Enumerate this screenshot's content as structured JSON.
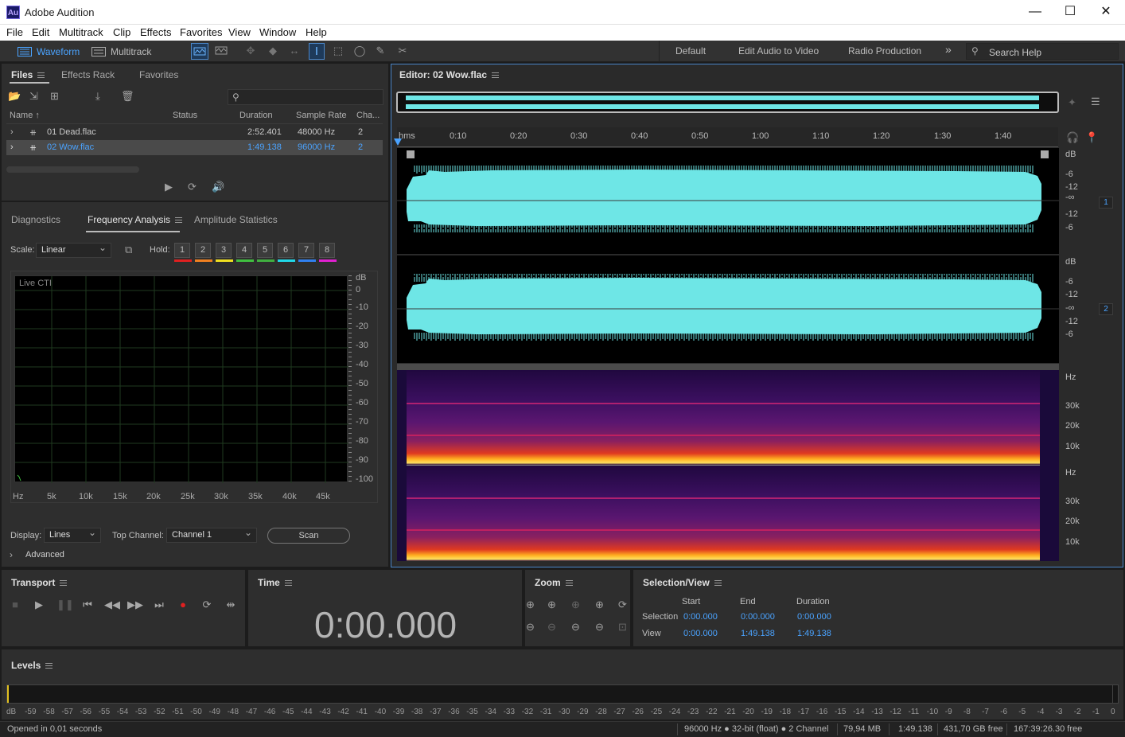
{
  "app": {
    "icon": "Au",
    "title": "Adobe Audition"
  },
  "window_controls": {
    "minimize": "—",
    "maximize": "☐",
    "close": "✕"
  },
  "menu": [
    "File",
    "Edit",
    "Multitrack",
    "Clip",
    "Effects",
    "Favorites",
    "View",
    "Window",
    "Help"
  ],
  "toolbar": {
    "waveform_label": "Waveform",
    "multitrack_label": "Multitrack",
    "workspaces": [
      "Default",
      "Edit Audio to Video",
      "Radio Production"
    ],
    "more": "»",
    "search_placeholder": "Search Help"
  },
  "files_panel": {
    "tabs": [
      "Files",
      "Effects Rack",
      "Favorites"
    ],
    "columns": {
      "name": "Name ↑",
      "status": "Status",
      "duration": "Duration",
      "sample_rate": "Sample Rate",
      "channels": "Cha..."
    },
    "rows": [
      {
        "name": "01 Dead.flac",
        "status": "",
        "duration": "2:52.401",
        "sample_rate": "48000 Hz",
        "channels": "2",
        "selected": false
      },
      {
        "name": "02 Wow.flac",
        "status": "",
        "duration": "1:49.138",
        "sample_rate": "96000 Hz",
        "channels": "2",
        "selected": true
      }
    ]
  },
  "analysis_panel": {
    "tabs": [
      "Diagnostics",
      "Frequency Analysis",
      "Amplitude Statistics"
    ],
    "scale_label": "Scale:",
    "scale_value": "Linear",
    "hold_label": "Hold:",
    "hold_buttons": [
      "1",
      "2",
      "3",
      "4",
      "5",
      "6",
      "7",
      "8"
    ],
    "hold_colors": [
      "#e02020",
      "#f08020",
      "#f0e020",
      "#40c040",
      "#40b040",
      "#20d8e8",
      "#3080f0",
      "#e020d0"
    ],
    "live_cti": "Live CTI",
    "db_labels": [
      "dB",
      "0",
      "-10",
      "-20",
      "-30",
      "-40",
      "-50",
      "-60",
      "-70",
      "-80",
      "-90",
      "-100"
    ],
    "hz_labels": [
      "Hz",
      "5k",
      "10k",
      "15k",
      "20k",
      "25k",
      "30k",
      "35k",
      "40k",
      "45k"
    ],
    "display_label": "Display:",
    "display_value": "Lines",
    "top_channel_label": "Top Channel:",
    "top_channel_value": "Channel 1",
    "scan_label": "Scan",
    "advanced_label": "Advanced"
  },
  "editor": {
    "title": "Editor: 02 Wow.flac",
    "ruler": [
      "hms",
      "0:10",
      "0:20",
      "0:30",
      "0:40",
      "0:50",
      "1:00",
      "1:10",
      "1:20",
      "1:30",
      "1:40"
    ],
    "db_scale": [
      "dB",
      "-6",
      "-12",
      "-∞",
      "-12",
      "-6"
    ],
    "hz_scale": [
      "Hz",
      "30k",
      "20k",
      "10k"
    ],
    "channel_badges": [
      "1",
      "2"
    ],
    "waveform_color": "#6ee6e6"
  },
  "transport": {
    "title": "Transport"
  },
  "time": {
    "title": "Time",
    "value": "0:00.000"
  },
  "zoom": {
    "title": "Zoom"
  },
  "selection_view": {
    "title": "Selection/View",
    "headers": [
      "Start",
      "End",
      "Duration"
    ],
    "rows": [
      {
        "label": "Selection",
        "start": "0:00.000",
        "end": "0:00.000",
        "duration": "0:00.000"
      },
      {
        "label": "View",
        "start": "0:00.000",
        "end": "1:49.138",
        "duration": "1:49.138"
      }
    ]
  },
  "levels": {
    "title": "Levels",
    "scale": [
      "dB",
      "-59",
      "-58",
      "-57",
      "-56",
      "-55",
      "-54",
      "-53",
      "-52",
      "-51",
      "-50",
      "-49",
      "-48",
      "-47",
      "-46",
      "-45",
      "-44",
      "-43",
      "-42",
      "-41",
      "-40",
      "-39",
      "-38",
      "-37",
      "-36",
      "-35",
      "-34",
      "-33",
      "-32",
      "-31",
      "-30",
      "-29",
      "-28",
      "-27",
      "-26",
      "-25",
      "-24",
      "-23",
      "-22",
      "-21",
      "-20",
      "-19",
      "-18",
      "-17",
      "-16",
      "-15",
      "-14",
      "-13",
      "-12",
      "-11",
      "-10",
      "-9",
      "-8",
      "-7",
      "-6",
      "-5",
      "-4",
      "-3",
      "-2",
      "-1",
      "0"
    ]
  },
  "status": {
    "message": "Opened in 0,01 seconds",
    "format": "96000 Hz ● 32-bit (float) ● 2 Channel",
    "size": "79,94 MB",
    "duration": "1:49.138",
    "free": "431,70 GB free",
    "free_time": "167:39:26.30 free"
  }
}
